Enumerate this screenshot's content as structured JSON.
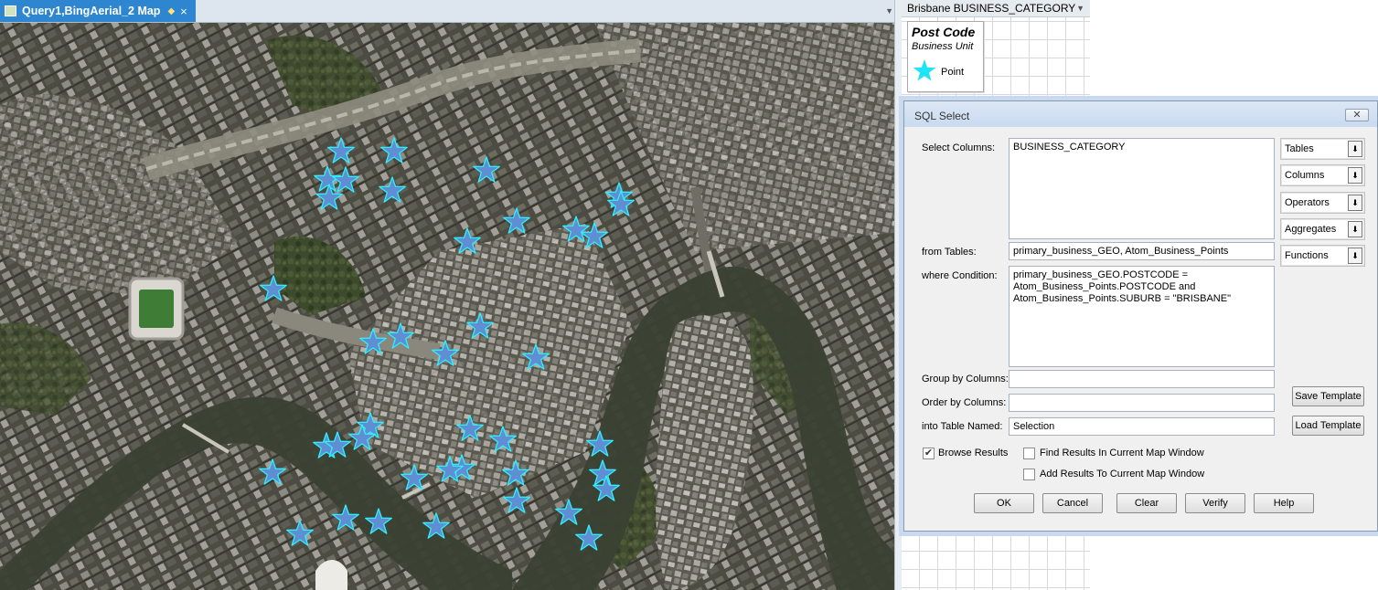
{
  "map_window": {
    "tab_title": "Query1,BingAerial_2 Map",
    "map_icon": "map-window-icon",
    "pin_icon": "pin-diamond-icon",
    "close_icon": "close-icon",
    "point_symbol_color": "#5f8fd2",
    "point_outline_color": "#2ef0ff"
  },
  "legend": {
    "header": "Brisbane BUSINESS_CATEGORY",
    "title": "Post Code",
    "subtitle": "Business Unit",
    "item_label": "Point",
    "item_icon": "star-icon",
    "item_color": "#1ee4f5"
  },
  "dialog": {
    "title": "SQL Select",
    "close_icon": "close-icon",
    "labels": {
      "select_columns": "Select Columns:",
      "from_tables": "from Tables:",
      "where_condition": "where Condition:",
      "group_by": "Group by Columns:",
      "order_by": "Order by Columns:",
      "into_table": "into Table Named:"
    },
    "values": {
      "select_columns": "BUSINESS_CATEGORY",
      "from_tables": "primary_business_GEO, Atom_Business_Points",
      "where_condition": "primary_business_GEO.POSTCODE =\nAtom_Business_Points.POSTCODE and\nAtom_Business_Points.SUBURB = \"BRISBANE\"",
      "group_by": "",
      "order_by": "",
      "into_table": "Selection"
    },
    "combos": [
      "Tables",
      "Columns",
      "Operators",
      "Aggregates",
      "Functions"
    ],
    "side_buttons": {
      "save": "Save Template",
      "load": "Load Template"
    },
    "checkboxes": {
      "browse": {
        "label": "Browse Results",
        "checked": true
      },
      "find": {
        "label": "Find Results In Current Map Window",
        "checked": false
      },
      "add": {
        "label": "Add Results To Current Map Window",
        "checked": false
      }
    },
    "buttons": {
      "ok": "OK",
      "cancel": "Cancel",
      "clear": "Clear",
      "verify": "Verify",
      "help": "Help"
    }
  }
}
